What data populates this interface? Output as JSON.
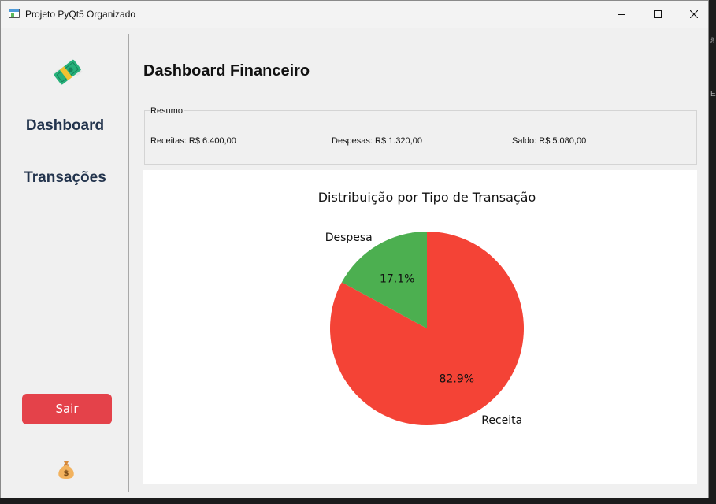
{
  "window": {
    "title": "Projeto PyQt5 Organizado"
  },
  "sidebar": {
    "logo_icon": "money-with-wings-icon",
    "items": [
      {
        "label": "Dashboard"
      },
      {
        "label": "Transações"
      }
    ],
    "logout_label": "Sair",
    "footer_icon": "money-bag-icon",
    "colors": {
      "nav_text": "#23344d",
      "logout_bg": "#e4424a"
    }
  },
  "main": {
    "title": "Dashboard Financeiro",
    "summary": {
      "legend": "Resumo",
      "receitas": "Receitas: R$ 6.400,00",
      "despesas": "Despesas: R$ 1.320,00",
      "saldo": "Saldo: R$ 5.080,00"
    }
  },
  "chart_data": {
    "type": "pie",
    "title": "Distribuição por Tipo de Transação",
    "categories": [
      "Receita",
      "Despesa"
    ],
    "values": [
      6400,
      1320
    ],
    "labels": [
      "82.9%",
      "17.1%"
    ],
    "colors": [
      "#f44336",
      "#4caf50"
    ],
    "legend": "none"
  },
  "edge": {
    "glyph_top": "ã",
    "glyph_bottom": "E"
  }
}
